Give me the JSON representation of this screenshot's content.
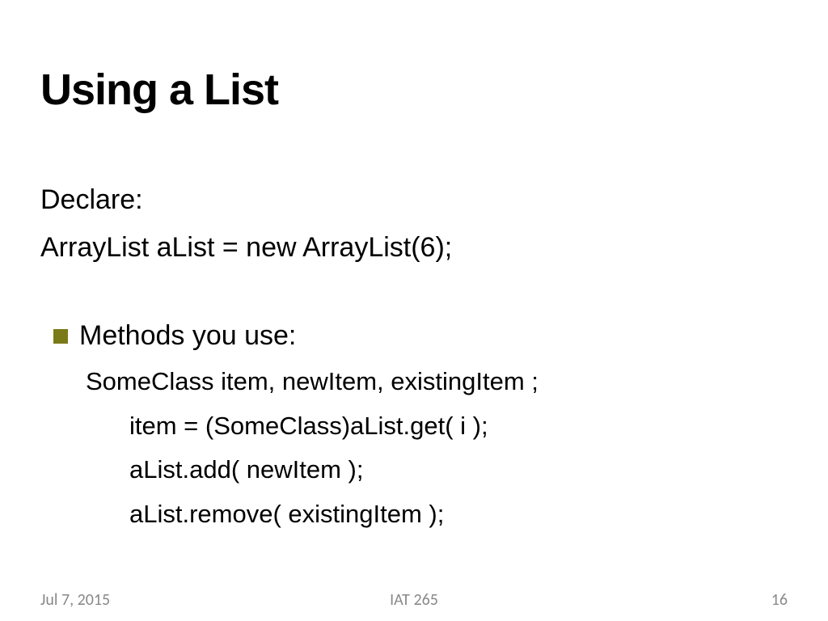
{
  "slide": {
    "title": "Using a List",
    "lines": {
      "declare_label": "Declare:",
      "declare_code": "ArrayList aList = new ArrayList(6);",
      "methods_label": "Methods you use:",
      "code1": "SomeClass item, newItem, existingItem ;",
      "code2": "item = (SomeClass)aList.get( i );",
      "code3": "aList.add( newItem );",
      "code4": "aList.remove( existingItem );"
    }
  },
  "footer": {
    "date": "Jul 7, 2015",
    "course": "IAT 265",
    "page": "16"
  }
}
